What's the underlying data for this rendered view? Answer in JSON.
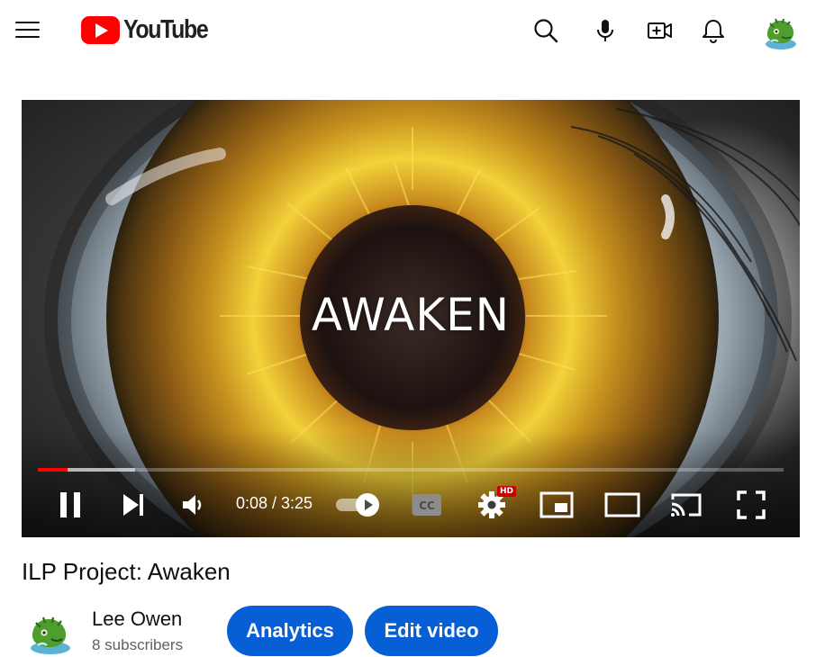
{
  "brand": {
    "name": "YouTube",
    "color": "#ff0000"
  },
  "header": {
    "icons": [
      "menu-icon",
      "search-icon",
      "microphone-icon",
      "create-video-icon",
      "notifications-bell-icon",
      "account-avatar"
    ]
  },
  "video": {
    "overlay_text": "AWAKEN",
    "current_time": "0:08",
    "duration": "3:25",
    "time_display": "0:08 / 3:25",
    "played_fraction": 0.04,
    "buffered_fraction": 0.13,
    "quality_badge": "HD",
    "autoplay_on": true,
    "progress_color": "#ff0000"
  },
  "details": {
    "title": "ILP Project: Awaken",
    "channel_name": "Lee Owen",
    "subscribers": "8 subscribers"
  },
  "actions": {
    "analytics_label": "Analytics",
    "edit_label": "Edit video",
    "button_color": "#065fd4"
  }
}
